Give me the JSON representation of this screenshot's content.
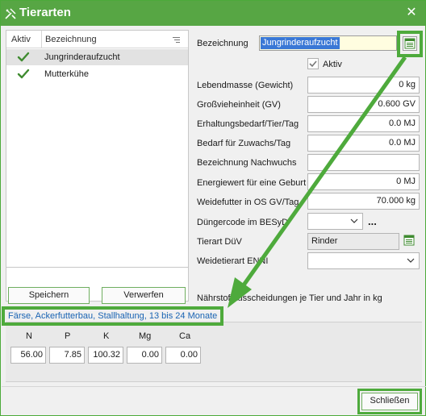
{
  "window": {
    "title": "Tierarten",
    "close_label": "✕",
    "accent_color": "#57a644"
  },
  "list": {
    "col_active": "Aktiv",
    "col_name": "Bezeichnung",
    "rows": [
      {
        "active": true,
        "name": "Jungrinderaufzucht",
        "selected": true
      },
      {
        "active": true,
        "name": "Mutterkühe",
        "selected": false
      }
    ]
  },
  "buttons": {
    "save": "Speichern",
    "discard": "Verwerfen",
    "close": "Schließen"
  },
  "form": {
    "bezeichnung_label": "Bezeichnung",
    "bezeichnung_value": "Jungrinderaufzucht",
    "aktiv_label": "Aktiv",
    "aktiv_checked": true,
    "lebendmasse_label": "Lebendmasse (Gewicht)",
    "lebendmasse_value": "0 kg",
    "gv_label": "Großvieheinheit (GV)",
    "gv_value": "0.600 GV",
    "erhaltung_label": "Erhaltungsbedarf/Tier/Tag",
    "erhaltung_value": "0.0 MJ",
    "zuwachs_label": "Bedarf für Zuwachs/Tag",
    "zuwachs_value": "0.0 MJ",
    "nachwuchs_label": "Bezeichnung Nachwuchs",
    "nachwuchs_value": "",
    "energie_label": "Energiewert für eine Geburt",
    "energie_value": "0 MJ",
    "weidefutter_label": "Weidefutter in OS GV/Tag",
    "weidefutter_value": "70.000 kg",
    "duenger_label": "Düngercode im BESyD",
    "duenger_value": "",
    "tierart_duev_label": "Tierart DüV",
    "tierart_duev_value": "Rinder",
    "weidetierart_label": "Weidetierart ENNI",
    "weidetierart_value": ""
  },
  "naehrstoff": {
    "title": "Nährstoffausscheidungen je Tier und Jahr in kg",
    "description": "Färse, Ackerfutterbau, Stallhaltung, 13 bis 24 Monate",
    "headers": [
      "N",
      "P",
      "K",
      "Mg",
      "Ca"
    ],
    "values": [
      "56.00",
      "7.85",
      "100.32",
      "0.00",
      "0.00"
    ]
  },
  "icons": {
    "title": "tools-icon",
    "check": "checkmark-icon",
    "lookup": "list-lookup-icon",
    "dropdown": "chevron-down-icon"
  }
}
